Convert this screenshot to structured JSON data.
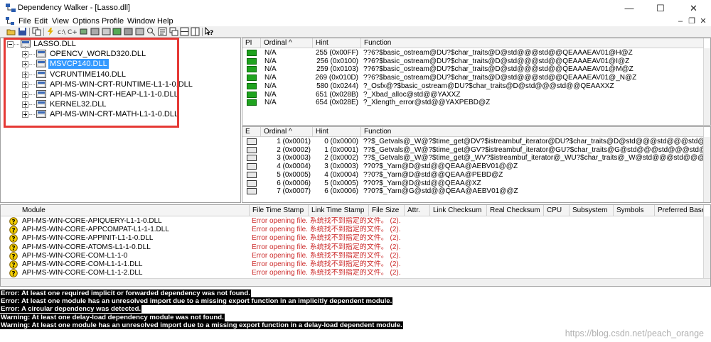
{
  "window": {
    "title": "Dependency Walker - [Lasso.dll]",
    "minimize": "—",
    "maximize": "☐",
    "close": "✕"
  },
  "menu": [
    "File",
    "Edit",
    "View",
    "Options",
    "Profile",
    "Window",
    "Help"
  ],
  "mdi": {
    "minimize": "–",
    "restore": "❐",
    "close": "✕"
  },
  "tree": {
    "root": "LASSO.DLL",
    "children": [
      {
        "name": "OPENCV_WORLD320.DLL"
      },
      {
        "name": "MSVCP140.DLL",
        "selected": true
      },
      {
        "name": "VCRUNTIME140.DLL"
      },
      {
        "name": "API-MS-WIN-CRT-RUNTIME-L1-1-0.DLL"
      },
      {
        "name": "API-MS-WIN-CRT-HEAP-L1-1-0.DLL"
      },
      {
        "name": "KERNEL32.DLL"
      },
      {
        "name": "API-MS-WIN-CRT-MATH-L1-1-0.DLL"
      }
    ]
  },
  "imports": {
    "headers": [
      "PI",
      "Ordinal ^",
      "Hint",
      "Function"
    ],
    "rows": [
      [
        "N/A",
        "255 (0x00FF)",
        "??6?$basic_ostream@DU?$char_traits@D@std@@@std@@QEAAAEAV01@H@Z"
      ],
      [
        "N/A",
        "256 (0x0100)",
        "??6?$basic_ostream@DU?$char_traits@D@std@@@std@@QEAAAEAV01@I@Z"
      ],
      [
        "N/A",
        "259 (0x0103)",
        "??6?$basic_ostream@DU?$char_traits@D@std@@@std@@QEAAAEAV01@M@Z"
      ],
      [
        "N/A",
        "269 (0x010D)",
        "??6?$basic_ostream@DU?$char_traits@D@std@@@std@@QEAAAEAV01@_N@Z"
      ],
      [
        "N/A",
        "580 (0x0244)",
        "?_Osfx@?$basic_ostream@DU?$char_traits@D@std@@@std@@QEAAXXZ"
      ],
      [
        "N/A",
        "651 (0x028B)",
        "?_Xbad_alloc@std@@YAXXZ"
      ],
      [
        "N/A",
        "654 (0x028E)",
        "?_Xlength_error@std@@YAXPEBD@Z"
      ]
    ]
  },
  "exports": {
    "headers": [
      "E",
      "Ordinal ^",
      "Hint",
      "Function"
    ],
    "rows": [
      [
        "1 (0x0001)",
        "0 (0x0000)",
        "??$_Getvals@_W@?$time_get@DV?$istreambuf_iterator@DU?$char_traits@D@std@@@std@@@std@@IEAAX_WAEB"
      ],
      [
        "2 (0x0002)",
        "1 (0x0001)",
        "??$_Getvals@_W@?$time_get@GV?$istreambuf_iterator@GU?$char_traits@G@std@@@std@@@std@@IEAAX_WAEB"
      ],
      [
        "3 (0x0003)",
        "2 (0x0002)",
        "??$_Getvals@_W@?$time_get@_WV?$istreambuf_iterator@_WU?$char_traits@_W@std@@@std@@@std@@IEAAX_WAE"
      ],
      [
        "4 (0x0004)",
        "3 (0x0003)",
        "??0?$_Yarn@D@std@@QEAA@AEBV01@@Z"
      ],
      [
        "5 (0x0005)",
        "4 (0x0004)",
        "??0?$_Yarn@D@std@@QEAA@PEBD@Z"
      ],
      [
        "6 (0x0006)",
        "5 (0x0005)",
        "??0?$_Yarn@D@std@@QEAA@XZ"
      ],
      [
        "7 (0x0007)",
        "6 (0x0006)",
        "??0?$_Yarn@G@std@@QEAA@AEBV01@@Z"
      ]
    ]
  },
  "modules": {
    "headers": [
      "Module",
      "File Time Stamp",
      "Link Time Stamp",
      "File Size",
      "Attr.",
      "Link Checksum",
      "Real Checksum",
      "CPU",
      "Subsystem",
      "Symbols",
      "Preferred Base"
    ],
    "rows": [
      {
        "name": "API-MS-WIN-CORE-APIQUERY-L1-1-0.DLL",
        "status": "Error opening file. 系统找不到指定的文件。 (2)."
      },
      {
        "name": "API-MS-WIN-CORE-APPCOMPAT-L1-1-1.DLL",
        "status": "Error opening file. 系统找不到指定的文件。 (2)."
      },
      {
        "name": "API-MS-WIN-CORE-APPINIT-L1-1-0.DLL",
        "status": "Error opening file. 系统找不到指定的文件。 (2)."
      },
      {
        "name": "API-MS-WIN-CORE-ATOMS-L1-1-0.DLL",
        "status": "Error opening file. 系统找不到指定的文件。 (2)."
      },
      {
        "name": "API-MS-WIN-CORE-COM-L1-1-0",
        "status": "Error opening file. 系统找不到指定的文件。 (2)."
      },
      {
        "name": "API-MS-WIN-CORE-COM-L1-1-1.DLL",
        "status": "Error opening file. 系统找不到指定的文件。 (2)."
      },
      {
        "name": "API-MS-WIN-CORE-COM-L1-1-2.DLL",
        "status": "Error opening file. 系统找不到指定的文件。 (2)."
      }
    ]
  },
  "log": [
    "Error: At least one required implicit or forwarded dependency was not found.",
    "Error: At least one module has an unresolved import due to a missing export function in an implicitly dependent module.",
    "Error: A circular dependency was detected.",
    "Warning: At least one delay-load dependency module was not found.",
    "Warning: At least one module has an unresolved import due to a missing export function in a delay-load dependent module."
  ],
  "watermark": "https://blog.csdn.net/peach_orange",
  "colors": {
    "highlight": "#3399ff",
    "error_text": "#cc2a2a",
    "annotation_box": "#e53935",
    "import_icon": "#1fa31f"
  }
}
